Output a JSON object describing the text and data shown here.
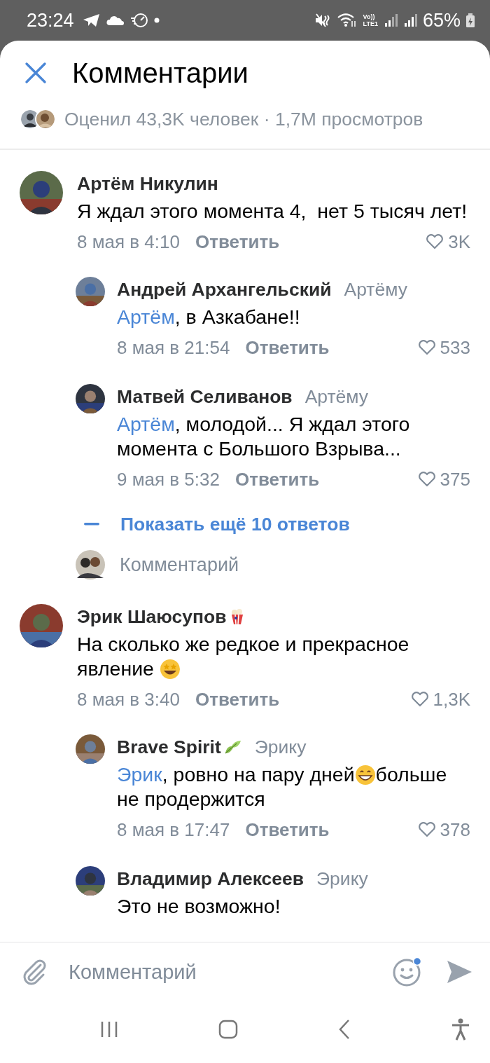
{
  "status_bar": {
    "time": "23:24",
    "network_label": [
      "Vo))",
      "LTE1"
    ],
    "battery": "65%"
  },
  "header": {
    "title": "Комментарии",
    "stats": "Оценил 43,3K человек · 1,7M просмотров"
  },
  "threads": [
    {
      "author": "Артём Никулин",
      "segments": [
        {
          "kind": "text",
          "text": "Я ждал этого момента 4,  нет 5 тысяч лет!"
        }
      ],
      "date": "8 мая в 4:10",
      "reply_label": "Ответить",
      "likes": "3K",
      "replies": [
        {
          "author": "Андрей Архангельский",
          "reply_to": "Артёму",
          "segments": [
            {
              "kind": "mention",
              "text": "Артём"
            },
            {
              "kind": "text",
              "text": ", в Азкабане!!"
            }
          ],
          "date": "8 мая в 21:54",
          "reply_label": "Ответить",
          "likes": "533"
        },
        {
          "author": "Матвей Селиванов",
          "reply_to": "Артёму",
          "segments": [
            {
              "kind": "mention",
              "text": "Артём"
            },
            {
              "kind": "text",
              "text": ", молодой... Я ждал этого момента с Большого Взрыва..."
            }
          ],
          "date": "9 мая в 5:32",
          "reply_label": "Ответить",
          "likes": "375"
        }
      ],
      "more_replies": "Показать ещё 10 ответов",
      "reply_placeholder": "Комментарий"
    },
    {
      "author": "Эрик Шаюсупов",
      "badge": {
        "kind": "popcorn"
      },
      "segments": [
        {
          "kind": "text",
          "text": "На сколько же редкое и прекрасное явление "
        },
        {
          "kind": "starstruck"
        }
      ],
      "date": "8 мая в 3:40",
      "reply_label": "Ответить",
      "likes": "1,3K",
      "replies": [
        {
          "author": "Brave Spirit",
          "badge": {
            "kind": "leaf"
          },
          "reply_to": "Эрику",
          "segments": [
            {
              "kind": "mention",
              "text": "Эрик"
            },
            {
              "kind": "text",
              "text": ", ровно на пару дней"
            },
            {
              "kind": "grin"
            },
            {
              "kind": "text",
              "text": "больше не продержится"
            }
          ],
          "date": "8 мая в 17:47",
          "reply_label": "Ответить",
          "likes": "378"
        },
        {
          "author": "Владимир Алексеев",
          "reply_to": "Эрику",
          "segments": [
            {
              "kind": "text",
              "text": "Это не возможно!"
            }
          ]
        }
      ]
    }
  ],
  "composer": {
    "placeholder": "Комментарий",
    "emoji_notification": true
  }
}
